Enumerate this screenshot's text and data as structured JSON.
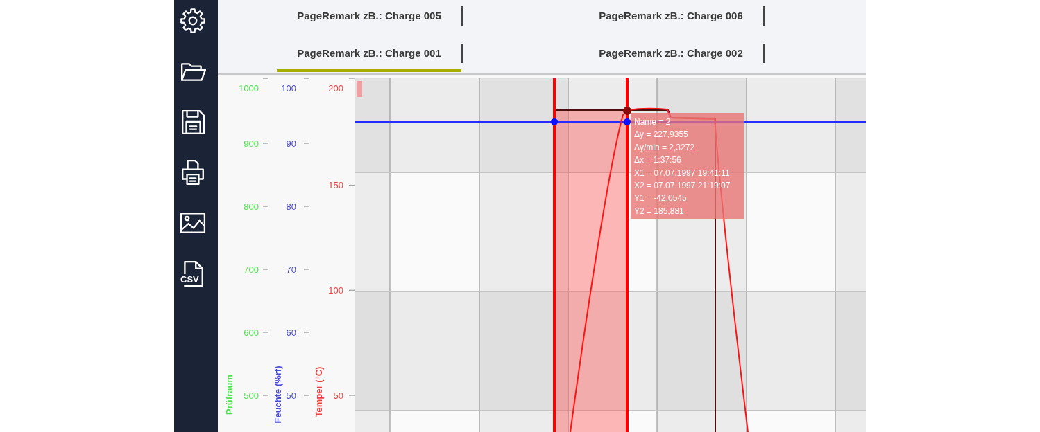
{
  "sidebar": {
    "csv_icon_text": "CSV"
  },
  "tab_rows": [
    {
      "tabs": [
        {
          "label": "PageRemark zB.: Charge 005",
          "selected": false
        },
        {
          "label": "PageRemark zB.: Charge 006",
          "selected": false
        }
      ]
    },
    {
      "tabs": [
        {
          "label": "PageRemark zB.: Charge 001",
          "selected": true
        },
        {
          "label": "PageRemark zB.: Charge 002",
          "selected": false
        }
      ]
    }
  ],
  "chart": {
    "axes": [
      {
        "title": "Prüfraum",
        "color": "#4ee44e",
        "ticks": [
          "1000",
          "900",
          "800",
          "700",
          "600",
          "500"
        ]
      },
      {
        "title": "Feuchte (%rf)",
        "color": "#4b4bdb",
        "ticks": [
          "100",
          "90",
          "80",
          "70",
          "60",
          "50"
        ]
      },
      {
        "title": "Temper (°C)",
        "color": "#f03c3c",
        "ticks": [
          "200",
          "150",
          "100",
          "50"
        ]
      }
    ],
    "tooltip": {
      "lines": [
        "Name = 2",
        "Δy = 227,9355",
        "Δy/min = 2,3272",
        "Δx = 1:37:56",
        "X1 = 07.07.1997 19:41:11",
        "X2 = 07.07.1997 21:19:07",
        "Y1 = -42,0545",
        "Y2 = 185,881"
      ]
    }
  }
}
